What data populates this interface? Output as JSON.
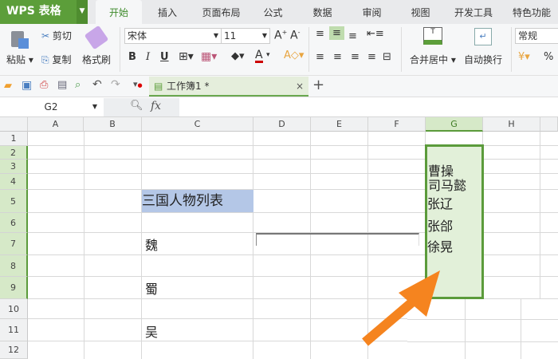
{
  "app": {
    "title": "WPS 表格"
  },
  "tabs": [
    "开始",
    "插入",
    "页面布局",
    "公式",
    "数据",
    "审阅",
    "视图",
    "开发工具",
    "特色功能"
  ],
  "active_tab": "开始",
  "ribbon": {
    "paste": "粘贴",
    "cut": "剪切",
    "copy": "复制",
    "format_painter": "格式刷",
    "font_name": "宋体",
    "font_size": "11",
    "bold": "B",
    "italic": "I",
    "underline": "U",
    "merge_center": "合并居中",
    "wrap_text": "自动换行",
    "number_format": "常规",
    "percent": "%"
  },
  "document_tab": {
    "title": "工作簿1 *",
    "close": "×",
    "new": "+"
  },
  "formula_bar": {
    "name_box": "G2",
    "fx": "fx",
    "value": ""
  },
  "columns": [
    "A",
    "B",
    "C",
    "D",
    "E",
    "F",
    "G",
    "H"
  ],
  "rows": [
    "1",
    "2",
    "3",
    "4",
    "5",
    "6",
    "7",
    "8",
    "9",
    "10",
    "11",
    "12"
  ],
  "cells": {
    "C5": "三国人物列表",
    "C7": "魏",
    "C9": "蜀",
    "C11": "吴",
    "G3": "曹操",
    "G4": "司马懿",
    "G5": "张辽",
    "G6": "张郃",
    "G7": "徐晃"
  },
  "selection": "G2:G9",
  "colors": {
    "accent": "#5c9e3a",
    "selection_fill": "#e2f0d9",
    "selection_border": "#5b9b3b",
    "title_fill": "#b4c7e7",
    "arrow": "#f5841f"
  }
}
